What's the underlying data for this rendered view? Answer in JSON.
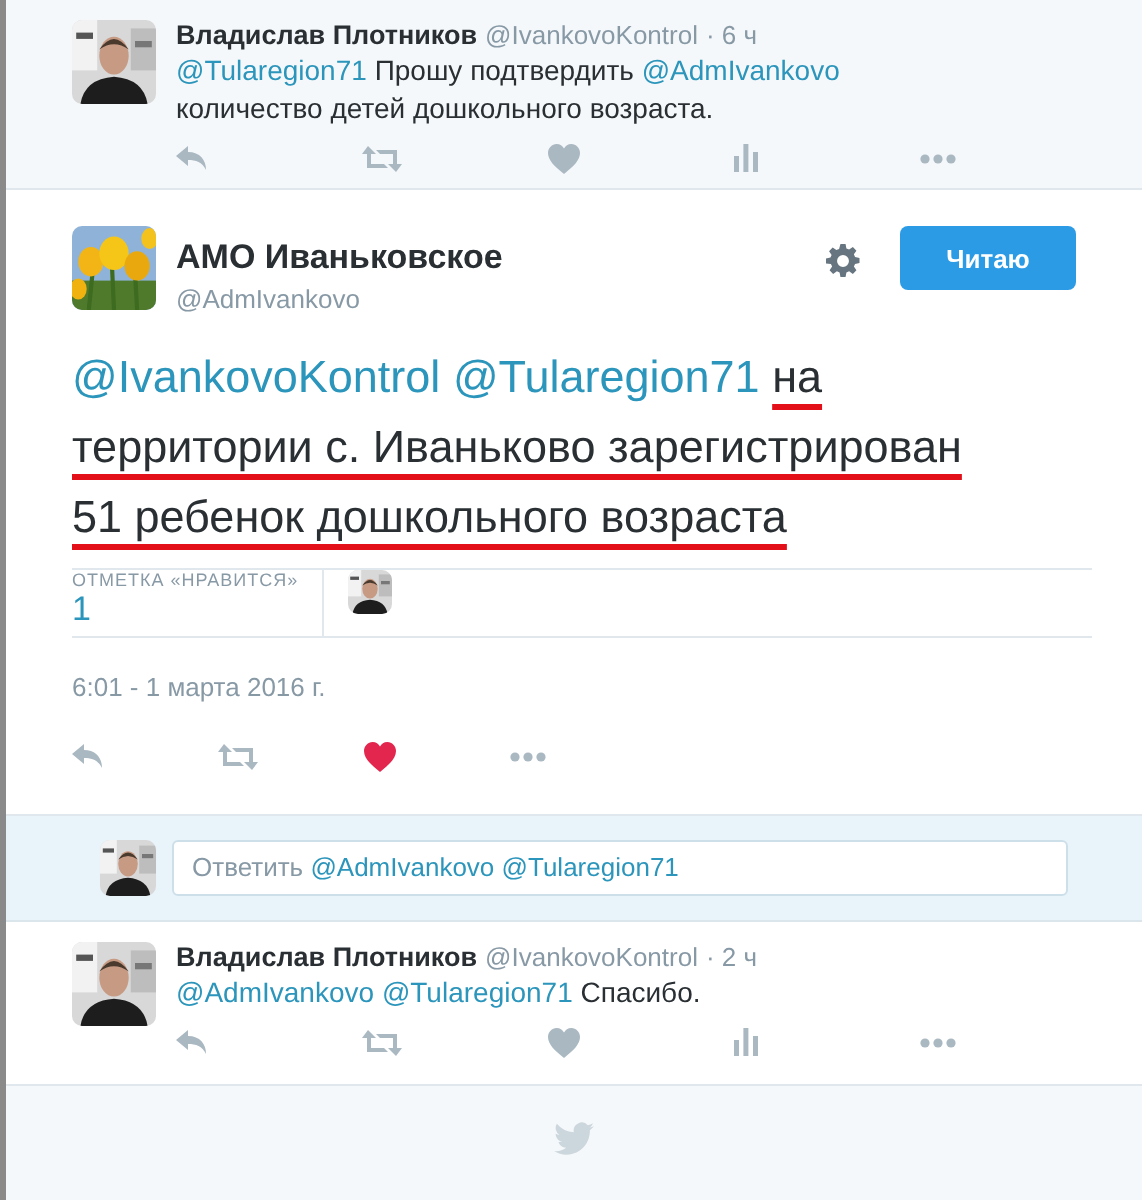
{
  "tweets_above": [
    {
      "author": "Владислав Плотников",
      "handle": "@IvankovoKontrol",
      "time": "· 6 ч",
      "text": [
        {
          "kind": "mention",
          "text": "@Tularegion71"
        },
        {
          "kind": "plain",
          "text": "Прошу подтвердить"
        },
        {
          "kind": "mention",
          "text": "@AdmIvankovo"
        },
        {
          "kind": "plain",
          "text": "количество детей дошкольного возраста."
        }
      ],
      "actions": [
        {
          "kind": "reply"
        },
        {
          "kind": "retweet"
        },
        {
          "kind": "like"
        },
        {
          "kind": "stats"
        },
        {
          "kind": "more"
        }
      ]
    }
  ],
  "main_tweet": {
    "author": "АМО Иваньковское",
    "handle": "@AdmIvankovo",
    "follow_button": "Читаю",
    "text": [
      {
        "kind": "mention",
        "text": "@IvankovoKontrol"
      },
      {
        "kind": "mention",
        "text": "@Tularegion71"
      },
      {
        "kind": "underlined",
        "text": "на территории с. Иваньково зарегистрирован 51 ребенок дошкольного возраста"
      }
    ],
    "likes_label": "ОТМЕТКА «НРАВИТСЯ»",
    "likes_count": "1",
    "date": "6:01 - 1 марта 2016 г.",
    "liked": true,
    "actions": [
      {
        "kind": "reply"
      },
      {
        "kind": "retweet"
      },
      {
        "kind": "like"
      },
      {
        "kind": "more"
      }
    ]
  },
  "reply_box": {
    "text": [
      {
        "kind": "plain",
        "text": "Ответить"
      },
      {
        "kind": "mention",
        "text": "@AdmIvankovo"
      },
      {
        "kind": "mention",
        "text": "@Tularegion71"
      }
    ]
  },
  "replies": [
    {
      "author": "Владислав Плотников",
      "handle": "@IvankovoKontrol",
      "time": "· 2 ч",
      "text": [
        {
          "kind": "mention",
          "text": "@AdmIvankovo"
        },
        {
          "kind": "mention",
          "text": "@Tularegion71"
        },
        {
          "kind": "plain",
          "text": "Спасибо."
        }
      ],
      "actions": [
        {
          "kind": "reply"
        },
        {
          "kind": "retweet"
        },
        {
          "kind": "like"
        },
        {
          "kind": "stats"
        },
        {
          "kind": "more"
        }
      ]
    }
  ]
}
